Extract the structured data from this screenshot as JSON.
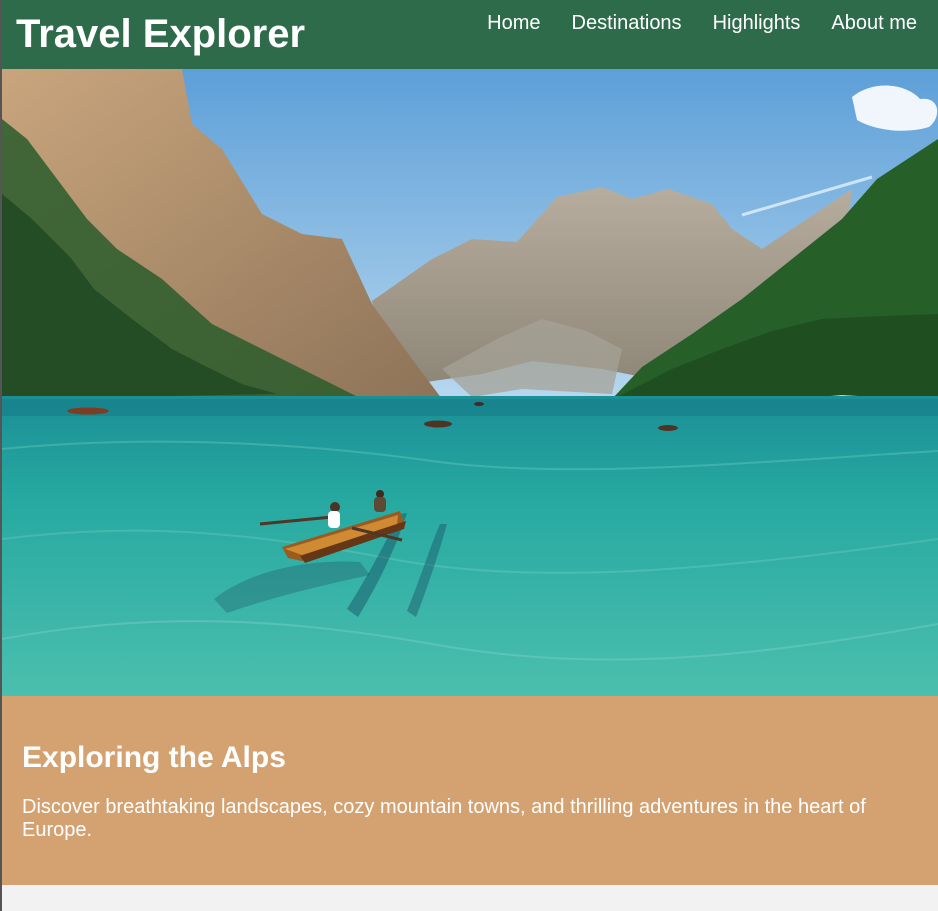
{
  "header": {
    "title": "Travel Explorer",
    "nav": [
      {
        "label": "Home"
      },
      {
        "label": "Destinations"
      },
      {
        "label": "Highlights"
      },
      {
        "label": "About me"
      }
    ]
  },
  "hero": {
    "image_subject": "alpine lake with rowing boats and mountains"
  },
  "intro": {
    "heading": "Exploring the Alps",
    "text": "Discover breathtaking landscapes, cozy mountain towns, and thrilling adventures in the heart of Europe."
  },
  "colors": {
    "header_bg": "#2e6b4a",
    "intro_bg": "#d4a270",
    "page_bg": "#f2f2f2",
    "text_light": "#ffffff"
  }
}
